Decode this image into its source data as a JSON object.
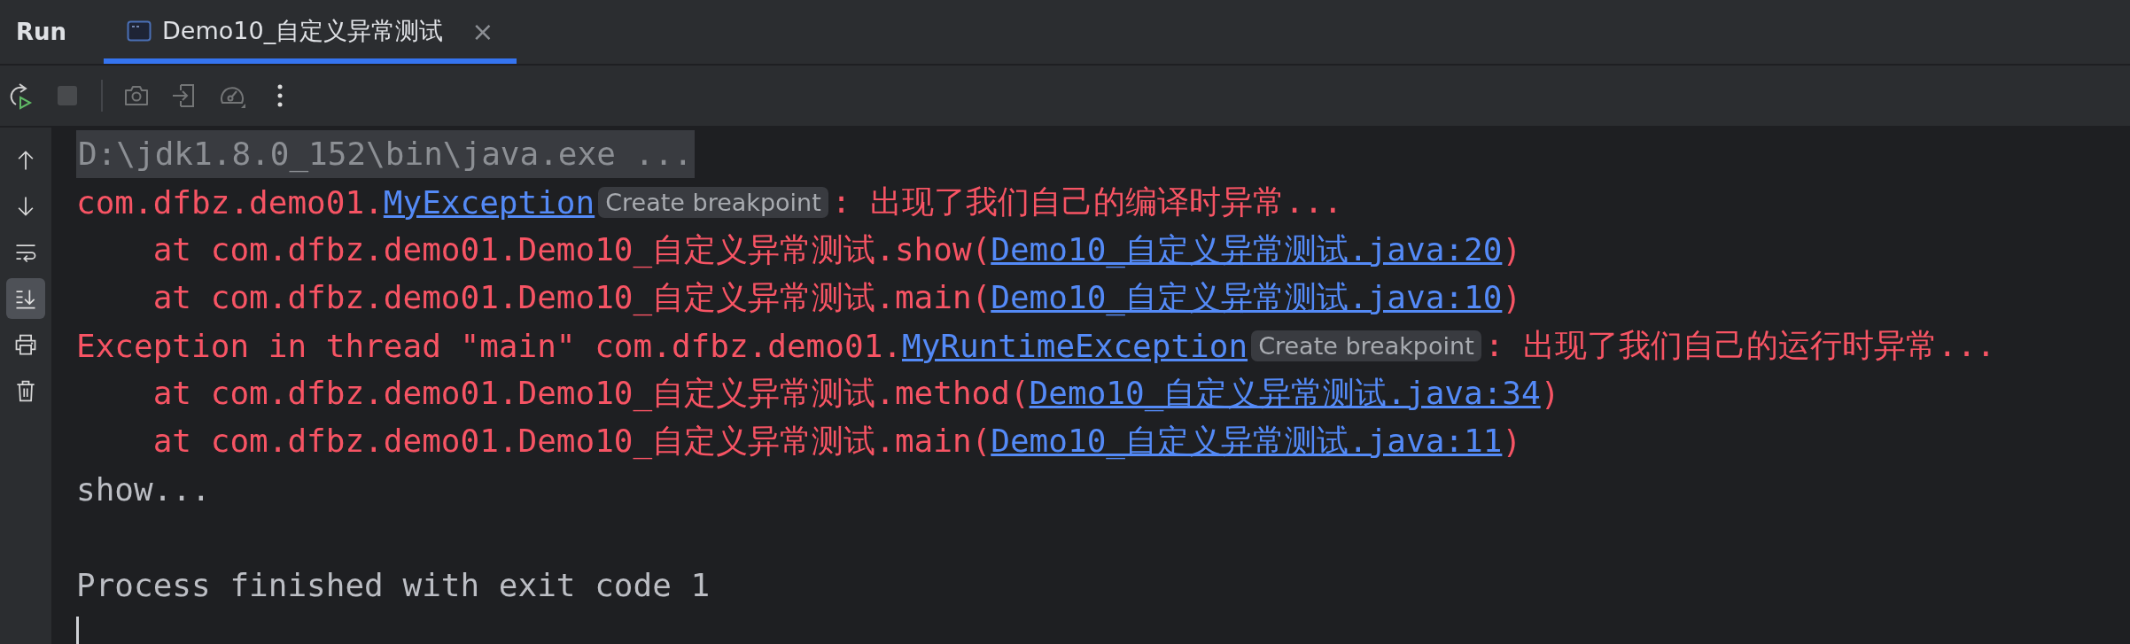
{
  "panel": {
    "title": "Run"
  },
  "tabs": [
    {
      "label": "Demo10_自定义异常测试",
      "selected": true,
      "close": "×"
    }
  ],
  "toolbar": [
    {
      "kind": "rerun",
      "disabled": false
    },
    {
      "kind": "stop",
      "disabled": true
    },
    {
      "kind": "separator",
      "disabled": false
    },
    {
      "kind": "camera",
      "disabled": true
    },
    {
      "kind": "enter",
      "disabled": true
    },
    {
      "kind": "gauge",
      "disabled": true
    },
    {
      "kind": "more",
      "disabled": false
    }
  ],
  "side_tools": [
    {
      "kind": "up",
      "on": false
    },
    {
      "kind": "down",
      "on": false
    },
    {
      "kind": "wrap",
      "on": false
    },
    {
      "kind": "scroll-end",
      "on": true
    },
    {
      "kind": "print",
      "on": false
    },
    {
      "kind": "trash",
      "on": false
    }
  ],
  "console": [
    {
      "kind": "output",
      "segments": [
        {
          "kind": "command",
          "text": "D:\\jdk1.8.0_152\\bin\\java.exe ..."
        }
      ]
    },
    {
      "kind": "output",
      "segments": [
        {
          "kind": "error",
          "text": "com.dfbz.demo01."
        },
        {
          "kind": "link",
          "text": "MyException"
        },
        {
          "kind": "hint",
          "text": "Create breakpoint"
        },
        {
          "kind": "error",
          "text": ": 出现了我们自己的编译时异常..."
        }
      ]
    },
    {
      "kind": "output",
      "segments": [
        {
          "kind": "error",
          "text": "    at com.dfbz.demo01.Demo10_自定义异常测试.show("
        },
        {
          "kind": "link",
          "text": "Demo10_自定义异常测试.java:20"
        },
        {
          "kind": "error",
          "text": ")"
        }
      ]
    },
    {
      "kind": "output",
      "segments": [
        {
          "kind": "error",
          "text": "    at com.dfbz.demo01.Demo10_自定义异常测试.main("
        },
        {
          "kind": "link",
          "text": "Demo10_自定义异常测试.java:10"
        },
        {
          "kind": "error",
          "text": ")"
        }
      ]
    },
    {
      "kind": "output",
      "segments": [
        {
          "kind": "error",
          "text": "Exception in thread \"main\" com.dfbz.demo01."
        },
        {
          "kind": "link",
          "text": "MyRuntimeException"
        },
        {
          "kind": "hint",
          "text": "Create breakpoint"
        },
        {
          "kind": "error",
          "text": ": 出现了我们自己的运行时异常..."
        }
      ]
    },
    {
      "kind": "output",
      "segments": [
        {
          "kind": "error",
          "text": "    at com.dfbz.demo01.Demo10_自定义异常测试.method("
        },
        {
          "kind": "link",
          "text": "Demo10_自定义异常测试.java:34"
        },
        {
          "kind": "error",
          "text": ")"
        }
      ]
    },
    {
      "kind": "output",
      "segments": [
        {
          "kind": "error",
          "text": "    at com.dfbz.demo01.Demo10_自定义异常测试.main("
        },
        {
          "kind": "link",
          "text": "Demo10_自定义异常测试.java:11"
        },
        {
          "kind": "error",
          "text": ")"
        }
      ]
    },
    {
      "kind": "output",
      "segments": [
        {
          "kind": "plain",
          "text": "show..."
        }
      ]
    },
    {
      "kind": "blank"
    },
    {
      "kind": "output",
      "segments": [
        {
          "kind": "plain",
          "text": "Process finished with exit code 1"
        }
      ]
    }
  ]
}
